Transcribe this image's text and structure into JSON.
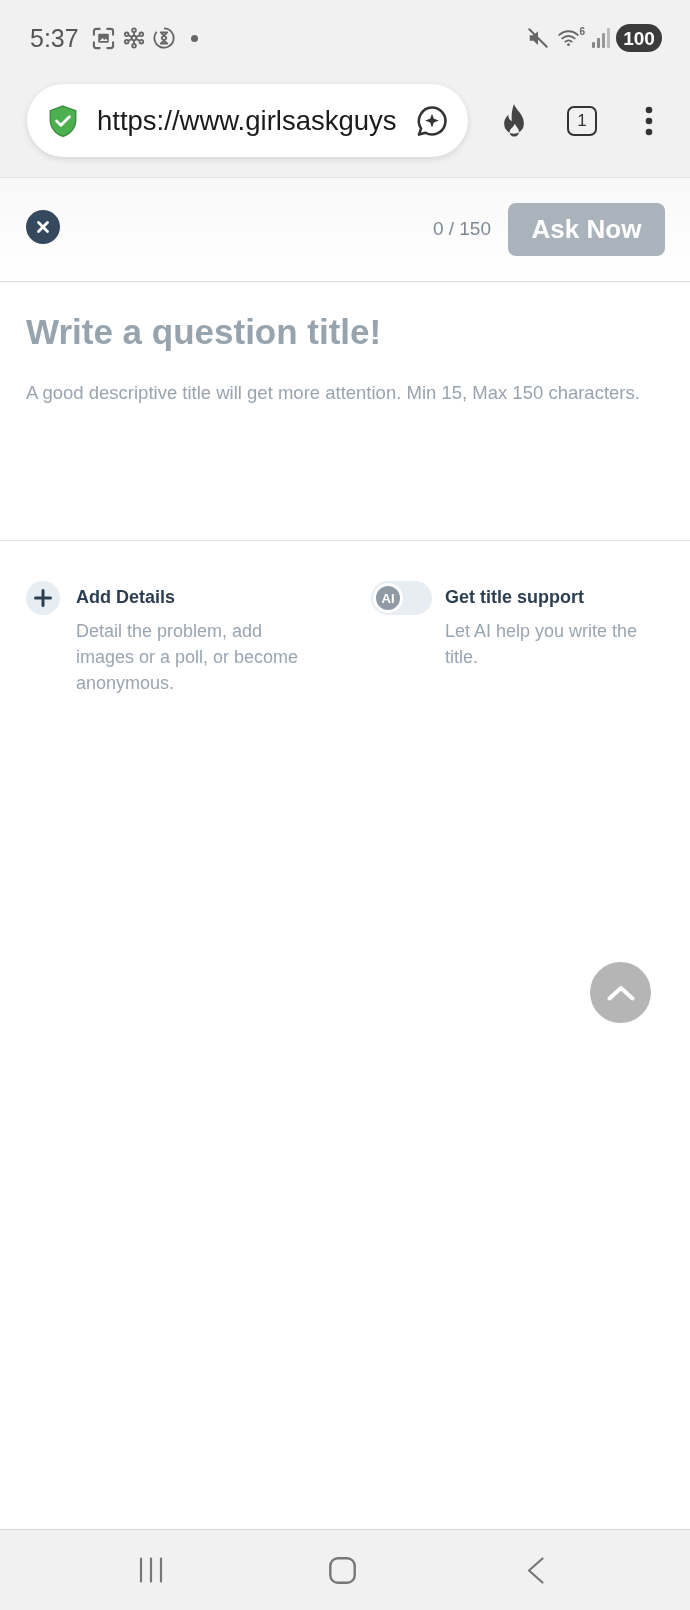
{
  "status_bar": {
    "time": "5:37",
    "wifi_generation": "6",
    "battery": "100"
  },
  "browser": {
    "url": "https://www.girlsaskguys",
    "tab_count": "1"
  },
  "header": {
    "char_count": "0 / 150",
    "ask_button": {
      "label": "Ask Now",
      "disabled": true
    }
  },
  "title_field": {
    "placeholder": "Write a question title!",
    "hint": "A good descriptive title will get more attention. Min 15, Max 150 characters."
  },
  "options": [
    {
      "kind": "add",
      "title": "Add Details",
      "description": "Detail the problem, add images or a poll, or become anonymous."
    },
    {
      "kind": "toggle",
      "thumb_label": "AI",
      "on": false,
      "title": "Get title support",
      "description": "Let AI help you write the title."
    }
  ]
}
